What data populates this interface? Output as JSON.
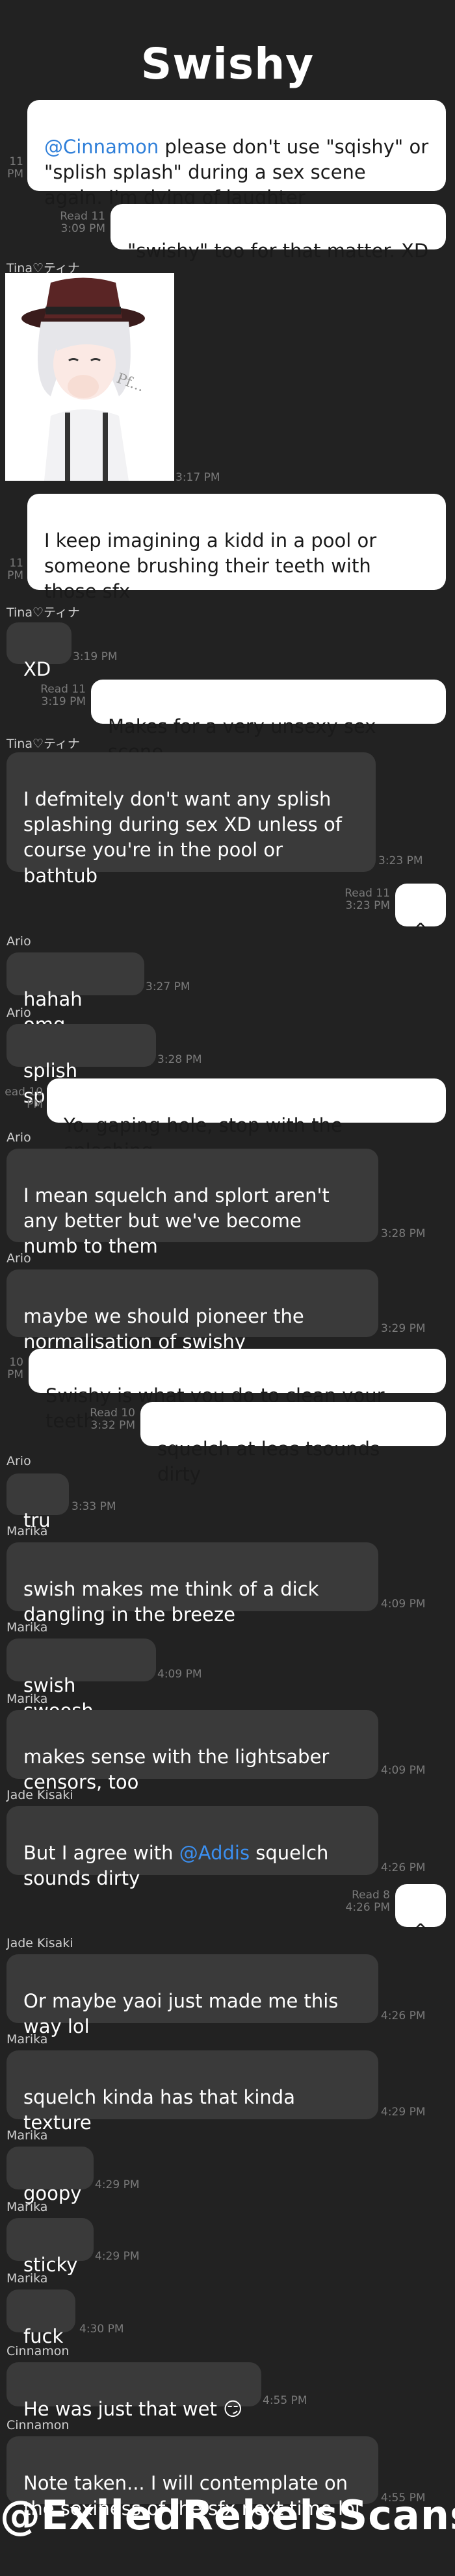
{
  "chat_title": "Swishy",
  "watermark": "@ExiledRebelsScans",
  "messages": [
    {
      "sender": "",
      "direction": "out",
      "mention": "@Cinnamon",
      "text": " please don't use \"sqishy\" or \"splish splash\" during a sex scene again. I'm dying of laughter",
      "time": "11\nPM"
    },
    {
      "sender": "",
      "direction": "out",
      "text": "\"swishy\" too for that matter. XD",
      "time": "Read 11\n3:09 PM"
    },
    {
      "sender": "Tina♡ティナ",
      "direction": "in",
      "sticker": "anime-boy-laughing",
      "time": "3:17 PM"
    },
    {
      "sender": "",
      "direction": "out",
      "text": "I keep imagining a kidd in a pool or someone brushing their teeth with those sfx",
      "time": "11\nPM"
    },
    {
      "sender": "Tina♡ティナ",
      "direction": "in",
      "text": "XD",
      "time": "3:19 PM"
    },
    {
      "sender": "",
      "direction": "out",
      "text": "Makes for a very unsexy sex scene",
      "time": "Read 11\n3:19 PM"
    },
    {
      "sender": "Tina♡ティナ",
      "direction": "in",
      "text": "I defmitely don't want any splish splashing during sex XD unless of course you're in the pool or bathtub",
      "time": "3:23 PM"
    },
    {
      "sender": "",
      "direction": "out",
      "text": "^",
      "time": "Read 11\n3:23 PM"
    },
    {
      "sender": "Ario",
      "direction": "in",
      "text": "hahah omg",
      "time": "3:27 PM"
    },
    {
      "sender": "Ario",
      "direction": "in",
      "text": "splish splash",
      "time": "3:28 PM"
    },
    {
      "sender": "",
      "direction": "out",
      "text": "Yo. gaping hole, stop with the splashing",
      "time": "ead 10\nPM"
    },
    {
      "sender": "Ario",
      "direction": "in",
      "text": "I mean squelch and splort aren't any better but we've become numb to them",
      "time": "3:28 PM"
    },
    {
      "sender": "Ario",
      "direction": "in",
      "text": "maybe we should pioneer the normalisation of swishy",
      "time": "3:29 PM"
    },
    {
      "sender": "",
      "direction": "out",
      "text": "Swishy is what you do to clean your teeth",
      "time": "10\nPM"
    },
    {
      "sender": "",
      "direction": "out",
      "text": "squelch at leas tsounds dirty",
      "time": "Read 10\n3:32 PM"
    },
    {
      "sender": "Ario",
      "direction": "in",
      "text": "tru",
      "time": "3:33 PM"
    },
    {
      "sender": "Marika",
      "direction": "in",
      "text": "swish makes me think of a dick dangling in the breeze",
      "time": "4:09 PM"
    },
    {
      "sender": "Marika",
      "direction": "in",
      "text": "swish swoosh",
      "time": "4:09 PM"
    },
    {
      "sender": "Marika",
      "direction": "in",
      "text": "makes sense with the lightsaber censors, too",
      "time": "4:09 PM"
    },
    {
      "sender": "Jade Kisaki",
      "direction": "in",
      "text_before": "But I agree with ",
      "mention": "@Addis",
      "text": " squelch sounds dirty",
      "time": "4:26 PM"
    },
    {
      "sender": "",
      "direction": "out",
      "text": "^",
      "time": "Read 8\n4:26 PM"
    },
    {
      "sender": "Jade Kisaki",
      "direction": "in",
      "text": "Or maybe yaoi just made me this way lol",
      "time": "4:26 PM"
    },
    {
      "sender": "Marika",
      "direction": "in",
      "text": "squelch kinda has that kinda texture",
      "time": "4:29 PM"
    },
    {
      "sender": "Marika",
      "direction": "in",
      "text": "goopy",
      "time": "4:29 PM"
    },
    {
      "sender": "Marika",
      "direction": "in",
      "text": "sticky",
      "time": "4:29 PM"
    },
    {
      "sender": "Marika",
      "direction": "in",
      "text": "fuck",
      "time": "4:30 PM"
    },
    {
      "sender": "Cinnamon",
      "direction": "in",
      "text": "He was just that wet 😏",
      "time": "4:55 PM"
    },
    {
      "sender": "Cinnamon",
      "direction": "in",
      "text": "Note taken... I will contemplate on the sexiness of the sfx next time lol",
      "time": "4:55 PM"
    }
  ]
}
